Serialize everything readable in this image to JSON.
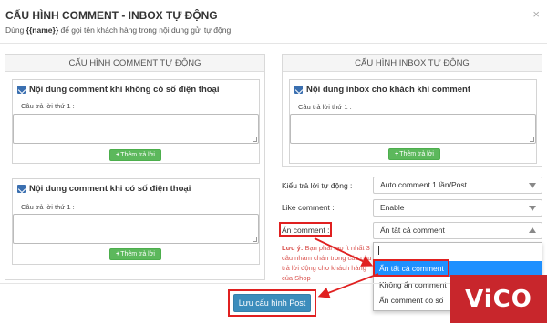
{
  "modal": {
    "title": "CẤU HÌNH COMMENT - INBOX TỰ ĐỘNG",
    "subtitle_prefix": "Dùng ",
    "subtitle_token": "{{name}}",
    "subtitle_suffix": " để gọi tên khách hàng trong nội dung gửi tự động.",
    "close_label": "×"
  },
  "comment_panel": {
    "heading": "CẤU HÌNH COMMENT TỰ ĐỘNG",
    "box_no_phone": {
      "title": "Nội dung comment khi không có số điện thoại",
      "answer_label": "Câu trả lời thứ 1 :",
      "add_label": "Thêm trả lời"
    },
    "box_phone": {
      "title": "Nội dung comment khi có số điện thoại",
      "answer_label": "Câu trả lời thứ 1 :",
      "add_label": "Thêm trả lời"
    }
  },
  "inbox_panel": {
    "heading": "CẤU HÌNH INBOX TỰ ĐỘNG",
    "box_inbox": {
      "title": "Nội dung inbox cho khách khi comment",
      "answer_label": "Câu trả lời thứ 1 :",
      "add_label": "Thêm trả lời"
    }
  },
  "settings": {
    "reply_type_label": "Kiểu trả lời tự động :",
    "reply_type_value": "Auto comment 1 lần/Post",
    "like_label": "Like comment :",
    "like_value": "Enable",
    "hide_label": "Ẩn comment :",
    "hide_value": "Ẩn tất cả comment",
    "hide_options": [
      "Ẩn tất cả comment",
      "Không ẩn comment",
      "Ẩn comment có số"
    ]
  },
  "note": {
    "bold": "Lưu ý:",
    "text": " Bạn phải tạo ít nhất 3 câu nhàm chán trong các câu trả lời động cho khách hàng của Shop"
  },
  "footer": {
    "save_label": "Lưu cấu hình Post"
  },
  "logo": {
    "text": "ViCO",
    "color": "#c8262c"
  },
  "colors": {
    "highlight": "#e02020",
    "primary": "#3c8dbc",
    "success": "#5cb85c",
    "selected_option": "#1e90ff"
  }
}
